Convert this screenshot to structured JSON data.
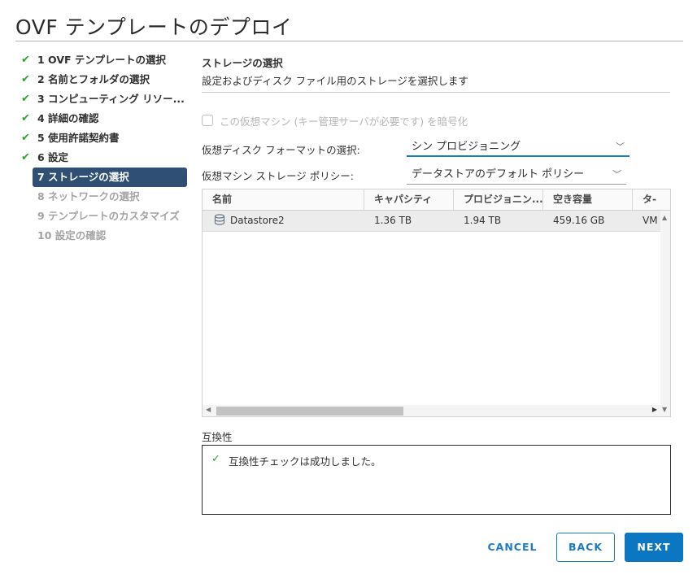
{
  "dialog": {
    "title": "OVF テンプレートのデプロイ"
  },
  "steps": [
    {
      "label": "1 OVF テンプレートの選択",
      "state": "done"
    },
    {
      "label": "2 名前とフォルダの選択",
      "state": "done"
    },
    {
      "label": "3 コンピューティング リソー...",
      "state": "done"
    },
    {
      "label": "4 詳細の確認",
      "state": "done"
    },
    {
      "label": "5 使用許諾契約書",
      "state": "done"
    },
    {
      "label": "6 設定",
      "state": "done"
    },
    {
      "label": "7 ストレージの選択",
      "state": "active"
    },
    {
      "label": "8 ネットワークの選択",
      "state": "todo"
    },
    {
      "label": "9 テンプレートのカスタマイズ",
      "state": "todo"
    },
    {
      "label": "10 設定の確認",
      "state": "todo"
    }
  ],
  "section": {
    "title": "ストレージの選択",
    "subtitle": "設定およびディスク ファイル用のストレージを選択します"
  },
  "encrypt": {
    "label": "この仮想マシン (キー管理サーバが必要です) を暗号化",
    "checked": false
  },
  "disk_format": {
    "label": "仮想ディスク フォーマットの選択:",
    "value": "シン プロビジョニング"
  },
  "storage_policy": {
    "label": "仮想マシン ストレージ ポリシー:",
    "value": "データストアのデフォルト ポリシー"
  },
  "table": {
    "columns": [
      "名前",
      "キャパシティ",
      "プロビジョニン...",
      "空き容量",
      "タ-"
    ],
    "rows": [
      {
        "name": "Datastore2",
        "capacity": "1.36 TB",
        "provisioned": "1.94 TB",
        "free": "459.16 GB",
        "type": "VM"
      }
    ]
  },
  "compatibility": {
    "title": "互換性",
    "message": "互換性チェックは成功しました。"
  },
  "buttons": {
    "cancel": "CANCEL",
    "back": "BACK",
    "next": "NEXT"
  },
  "colors": {
    "accent": "#0b77c2",
    "active_step": "#2f4f75",
    "success": "#2f9d2f"
  }
}
